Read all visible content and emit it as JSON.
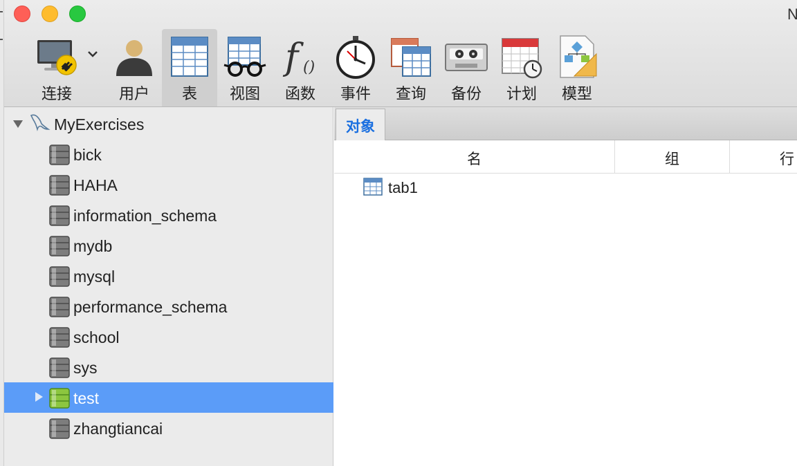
{
  "window": {
    "title_fragment": "N"
  },
  "toolbar": {
    "items": [
      {
        "label": "连接",
        "icon": "connection-icon"
      },
      {
        "label": "用户",
        "icon": "user-icon"
      },
      {
        "label": "表",
        "icon": "table-icon"
      },
      {
        "label": "视图",
        "icon": "view-icon"
      },
      {
        "label": "函数",
        "icon": "function-icon"
      },
      {
        "label": "事件",
        "icon": "event-icon"
      },
      {
        "label": "查询",
        "icon": "query-icon"
      },
      {
        "label": "备份",
        "icon": "backup-icon"
      },
      {
        "label": "计划",
        "icon": "schedule-icon"
      },
      {
        "label": "模型",
        "icon": "model-icon"
      }
    ],
    "active": "表"
  },
  "sidebar": {
    "connection": "MyExercises",
    "databases": [
      {
        "name": "bick"
      },
      {
        "name": "HAHA"
      },
      {
        "name": "information_schema"
      },
      {
        "name": "mydb"
      },
      {
        "name": "mysql"
      },
      {
        "name": "performance_schema"
      },
      {
        "name": "school"
      },
      {
        "name": "sys"
      },
      {
        "name": "test"
      },
      {
        "name": "zhangtiancai"
      }
    ],
    "selected": "test"
  },
  "main": {
    "tab_label": "对象",
    "columns": [
      "名",
      "组",
      "行"
    ],
    "objects": [
      {
        "name": "tab1"
      }
    ]
  },
  "colors": {
    "selection": "#5b9cf8",
    "tab_text": "#1a6fe0",
    "open_db": "#8cc63f"
  }
}
